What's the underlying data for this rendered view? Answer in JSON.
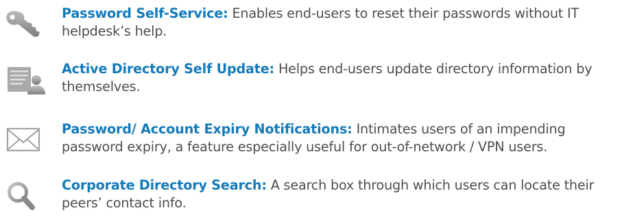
{
  "features": [
    {
      "icon": "key-icon",
      "title": "Password Self-Service:",
      "description": "Enables end-users to reset their passwords without IT helpdesk’s help."
    },
    {
      "icon": "user-profile-icon",
      "title": "Active Directory Self Update:",
      "description": "Helps end-users update directory information by themselves."
    },
    {
      "icon": "envelope-icon",
      "title": "Password/ Account Expiry Notifications:",
      "description": "Intimates users of an impending password expiry, a feature especially useful for out-of-network / VPN users."
    },
    {
      "icon": "magnifier-icon",
      "title": "Corporate Directory Search:",
      "description": "A search box through which users can locate their peers’ contact info."
    }
  ],
  "colors": {
    "title": "#157ab8",
    "text": "#4d4d4d",
    "icon": "#9a9a9a"
  }
}
